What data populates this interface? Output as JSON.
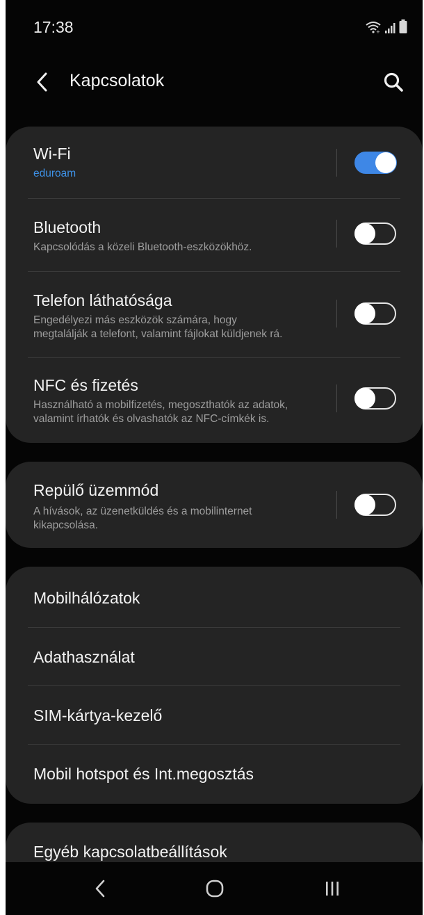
{
  "status_bar": {
    "time": "17:38",
    "icons": [
      "wifi-icon",
      "signal-icon",
      "battery-icon"
    ]
  },
  "header": {
    "back_icon": "chevron-left-icon",
    "title": "Kapcsolatok",
    "search_icon": "search-icon"
  },
  "group1": [
    {
      "title": "Wi-Fi",
      "subtitle": "eduroam",
      "toggle_on": true
    },
    {
      "title": "Bluetooth",
      "subtitle": "Kapcsolódás a közeli Bluetooth-eszközökhöz.",
      "toggle_on": false
    },
    {
      "title": "Telefon láthatósága",
      "subtitle_lines": [
        "Engedélyezi más eszközök számára, hogy",
        "megtalálják a telefont, valamint fájlokat küldjenek rá."
      ],
      "toggle_on": false
    },
    {
      "title": "NFC és fizetés",
      "subtitle_lines": [
        "Használható a mobilfizetés, megoszthatók az adatok,",
        "valamint írhatók és olvashatók az NFC-címkék is."
      ],
      "toggle_on": false
    }
  ],
  "group2": [
    {
      "title": "Repülő üzemmód",
      "subtitle_lines": [
        "A hívások, az üzenetküldés és a mobilinternet",
        "kikapcsolása."
      ],
      "toggle_on": false
    }
  ],
  "group3": [
    {
      "title": "Mobilhálózatok"
    },
    {
      "title": "Adathasználat"
    },
    {
      "title": "SIM-kártya-kezelő"
    },
    {
      "title": "Mobil hotspot és Int.megosztás"
    }
  ],
  "group4": [
    {
      "title": "Egyéb kapcsolatbeállítások"
    }
  ],
  "nav_bar": {
    "icons": [
      "back-icon",
      "home-icon",
      "recents-icon"
    ]
  },
  "colors": {
    "background": "#050505",
    "card": "#242424",
    "accent": "#3e87e6",
    "subtitle": "#9e9e9e"
  }
}
